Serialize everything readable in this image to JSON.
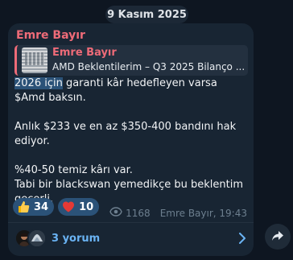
{
  "date_separator": "9 Kasım 2025",
  "message": {
    "author": "Emre Bayır",
    "reply": {
      "author": "Emre Bayır",
      "text": "AMD Beklentilerim – Q3 2025 Bilanço ..."
    },
    "paragraphs": [
      {
        "highlight": "2026 için",
        "rest": " garanti kâr hedefleyen varsa $Amd baksın."
      },
      {
        "text": "Anlık $233 ve en az $350-400 bandını hak ediyor."
      },
      {
        "line1": "%40-50 temiz kârı var.",
        "line2": "Tabi bir blackswan yemedikçe  bu beklentim geçerli."
      }
    ],
    "reactions": [
      {
        "icon": "thumbs-up-icon",
        "count": "34"
      },
      {
        "icon": "heart-icon",
        "count": "10"
      }
    ],
    "views": "1168",
    "signature": "Emre Bayır, 19:43",
    "comments_label": "3 yorum"
  },
  "colors": {
    "background": "#0e1621",
    "bubble": "#182533",
    "author": "#ee6b78",
    "link": "#6ab3f3",
    "reaction_bg": "#2b5278",
    "meta": "#6d7f8f"
  }
}
